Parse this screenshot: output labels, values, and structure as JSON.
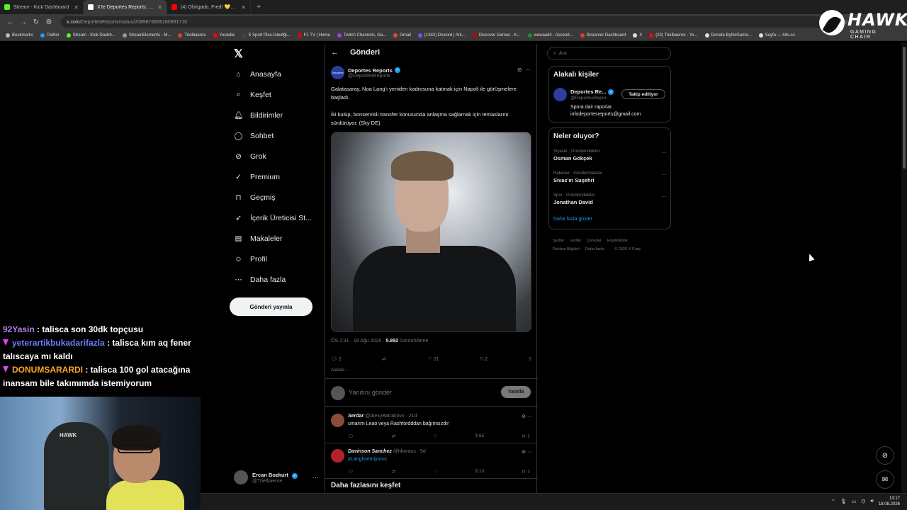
{
  "browser": {
    "tabs": [
      {
        "title": "Stream - Kick Dashboard",
        "color": "#53fc18",
        "active": false
      },
      {
        "title": "X'te Deportes Reports: \"Galata...",
        "color": "#ffffff",
        "active": true
      },
      {
        "title": "(4) Obrigado, Fred! 💛💙 | Ho...",
        "color": "#ff0000",
        "active": false
      }
    ],
    "new_tab": "+",
    "url_domain": "x.com",
    "url_path": "/DeportesReports/status/2089676656180891710",
    "bookmarks": [
      "Bookmarks",
      "Twitter",
      "Stream - Kick Dashb...",
      "StreamElements - M...",
      "Trielbaenre",
      "Youtube",
      "S Sport Plus-İstediği...",
      "F1 TV | Home",
      "Twitch Channels, Ga...",
      "Gmail",
      "(1342) Discord | Ark...",
      "Discover Games - K...",
      "wowaudit - Ascend...",
      "Streamer Dashboard",
      "X",
      "(23) Trielbaenre - Yo...",
      "Donate ByNoGame...",
      "Sayfa — hits.co"
    ]
  },
  "overlay_logo": {
    "title": "HAWK",
    "subtitle": "GAMING CHAIR"
  },
  "sidebar": {
    "items": [
      {
        "label": "Anasayfa",
        "icon": "home-icon"
      },
      {
        "label": "Keşfet",
        "icon": "search-icon"
      },
      {
        "label": "Bildirimler",
        "icon": "bell-icon"
      },
      {
        "label": "Sohbet",
        "icon": "chat-icon"
      },
      {
        "label": "Grok",
        "icon": "grok-icon"
      },
      {
        "label": "Premium",
        "icon": "premium-icon"
      },
      {
        "label": "Geçmiş",
        "icon": "bookmark-icon"
      },
      {
        "label": "İçerik Üreticisi St...",
        "icon": "rocket-icon"
      },
      {
        "label": "Makaleler",
        "icon": "article-icon"
      },
      {
        "label": "Profil",
        "icon": "profile-icon"
      },
      {
        "label": "Daha fazla",
        "icon": "more-icon"
      }
    ],
    "post_button": "Gönderi yayınla",
    "me": {
      "name": "Ercan Bozkurt",
      "handle": "@Trielbaenre"
    }
  },
  "post": {
    "header": "Gönderi",
    "author": {
      "name": "Deportes Reports",
      "handle": "@DeportesReports",
      "avatar_text": "Deportes"
    },
    "text1": "Galatasaray, Noa Lang'ı yeniden kadrosuna katmak için Napoli ile görüşmelere başladı.",
    "text2": "İki kulüp, bonservisli transfer konusunda anlaşma sağlamak için temaslarını sürdürüyor. (Sky DE)",
    "time": "ÖS 2:31 · 18 Ağu 2026 · ",
    "views": "5.892",
    "views_label": " Görüntüleme",
    "stats": {
      "replies": "2",
      "reposts": "",
      "likes": "31",
      "bookmarks": "2"
    },
    "relevant": "Alakalı ⌵",
    "reply_placeholder": "Yanıtını gönder",
    "reply_button": "Yanıtla"
  },
  "replies": [
    {
      "name": "Serdar",
      "handle": "@AlexyBatrakovv · 21d",
      "text": "umarım Leao veya Rashfordddan bağımsızdır",
      "likes": "",
      "views": "65",
      "avatar_color": "#8a4b3c"
    },
    {
      "name": "Davinson Sanchez",
      "handle": "@hkoraus · 5d",
      "text": "#Langİstemiyoruz",
      "likes": "",
      "views": "10",
      "avatar_color": "#b2222e"
    }
  ],
  "more_discover": "Daha fazlasını keşfet",
  "right": {
    "search_placeholder": "Ara",
    "relevant_people": {
      "title": "Alakalı kişiler",
      "name": "Deportes Re...",
      "handle": "@DeportesRepor...",
      "follow": "Takip ediliyor",
      "bio1": "Spora dair raporlar.",
      "bio2": "infodeportesreports@gmail.com"
    },
    "trends": {
      "title": "Neler oluyor?",
      "items": [
        {
          "category": "Siyaset · Gündemdekiler",
          "name": "Osman Gökçek"
        },
        {
          "category": "Haberler · Gündemdekiler",
          "name": "Sivas'ın Suşehri"
        },
        {
          "category": "Spor · Gündemdekiler",
          "name": "Jonathan David"
        }
      ],
      "show_more": "Daha fazla göster"
    },
    "footer": [
      "Şartlar",
      "Gizlilik",
      "Çerezler",
      "Erişilebilirlik",
      "Reklam Bilgileri",
      "Daha fazla ···",
      "© 2026 X Corp."
    ]
  },
  "chat": [
    {
      "user": "92Yasin",
      "text": ": talisca son 30dk topçusu",
      "badge": false
    },
    {
      "user": "yeterartikbukadarifazla",
      "text": ": talisca kım aq fener talıscaya mı kaldı",
      "badge": true
    },
    {
      "user": "DONUMSARARDI",
      "text": ": talisca 100 gol atacağına inansam bile takımımda istemiyorum",
      "badge": true
    }
  ],
  "webcam": {
    "chair_logo": "HAWK"
  },
  "taskbar": {
    "time": "13:17",
    "date": "18.08.2026"
  }
}
